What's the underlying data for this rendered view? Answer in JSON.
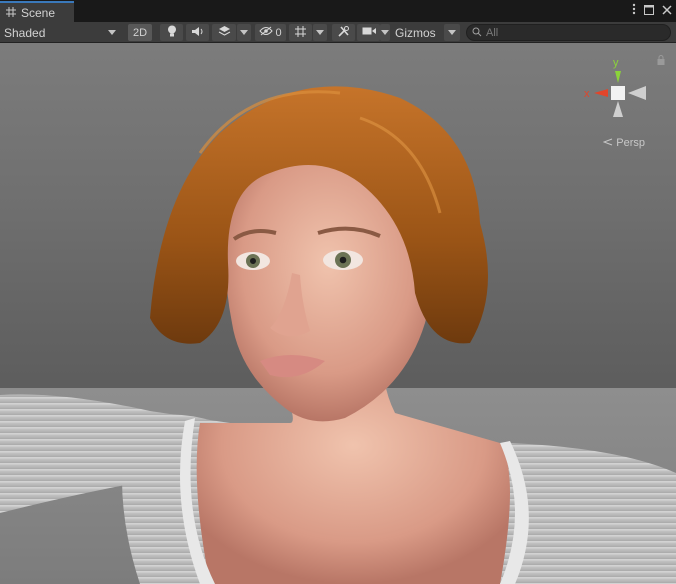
{
  "tab": {
    "label": "Scene",
    "icon": "grid-icon"
  },
  "window_controls": [
    "kebab-menu-icon",
    "maximize-icon",
    "close-icon"
  ],
  "toolbar": {
    "shading_mode": "Shaded",
    "toggle_2d": "2D",
    "hidden_count": "0",
    "gizmos_label": "Gizmos",
    "search_placeholder": "All"
  },
  "viewport": {
    "projection_label": "Persp",
    "axis_labels": {
      "x": "x",
      "y": "y"
    },
    "colors": {
      "x_axis": "#e2452a",
      "y_axis": "#8bd33a",
      "neutral": "#d8d8d8",
      "accent_tab": "#3a79bb"
    }
  }
}
